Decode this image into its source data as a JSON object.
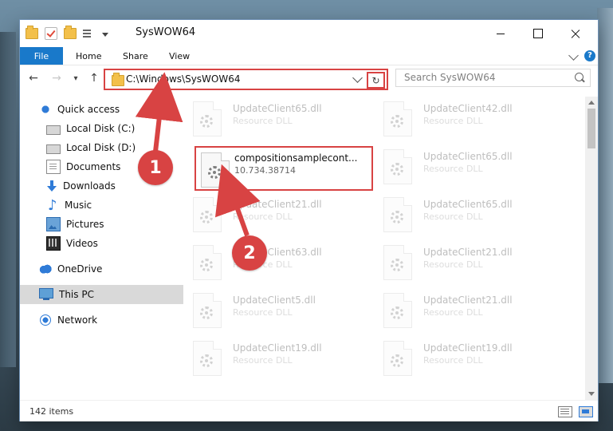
{
  "window": {
    "title": "SysWOW64",
    "tabs": [
      "File",
      "Home",
      "Share",
      "View"
    ],
    "help_icon": "?"
  },
  "navigation": {
    "address": "C:\\Windows\\SysWOW64",
    "search_placeholder": "Search SysWOW64"
  },
  "sidebar": {
    "items": [
      {
        "label": "Quick access",
        "icon": "star-icon"
      },
      {
        "label": "Local Disk (C:)",
        "icon": "drive-icon"
      },
      {
        "label": "Local Disk (D:)",
        "icon": "drive-icon"
      },
      {
        "label": "Documents",
        "icon": "document-icon"
      },
      {
        "label": "Downloads",
        "icon": "download-icon"
      },
      {
        "label": "Music",
        "icon": "music-icon"
      },
      {
        "label": "Pictures",
        "icon": "pictures-icon"
      },
      {
        "label": "Videos",
        "icon": "videos-icon"
      },
      {
        "label": "OneDrive",
        "icon": "onedrive-icon"
      },
      {
        "label": "This PC",
        "icon": "this-pc-icon"
      },
      {
        "label": "Network",
        "icon": "network-icon"
      }
    ]
  },
  "files": {
    "left_col": [
      {
        "name": "UpdateClient65.dll",
        "type": "Resource DLL"
      },
      {
        "name": "UpdateClient21.dll",
        "type": "Resource DLL"
      },
      {
        "name": "UpdateClient63.dll",
        "type": "Resource DLL"
      },
      {
        "name": "UpdateClient5.dll",
        "type": "Resource DLL"
      },
      {
        "name": "UpdateClient19.dll",
        "type": "Resource DLL"
      }
    ],
    "right_col": [
      {
        "name": "UpdateClient42.dll",
        "type": "Resource DLL"
      },
      {
        "name": "UpdateClient65.dll",
        "type": "Resource DLL"
      },
      {
        "name": "UpdateClient65.dll",
        "type": "Resource DLL"
      },
      {
        "name": "UpdateClient21.dll",
        "type": "Resource DLL"
      },
      {
        "name": "UpdateClient21.dll",
        "type": "Resource DLL"
      },
      {
        "name": "UpdateClient19.dll",
        "type": "Resource DLL"
      }
    ],
    "highlighted": {
      "name": "compositionsamplecont...",
      "version": "10.734.38714"
    }
  },
  "status": {
    "item_count": "142 items"
  },
  "annotations": {
    "marker_1": "1",
    "marker_2": "2"
  }
}
